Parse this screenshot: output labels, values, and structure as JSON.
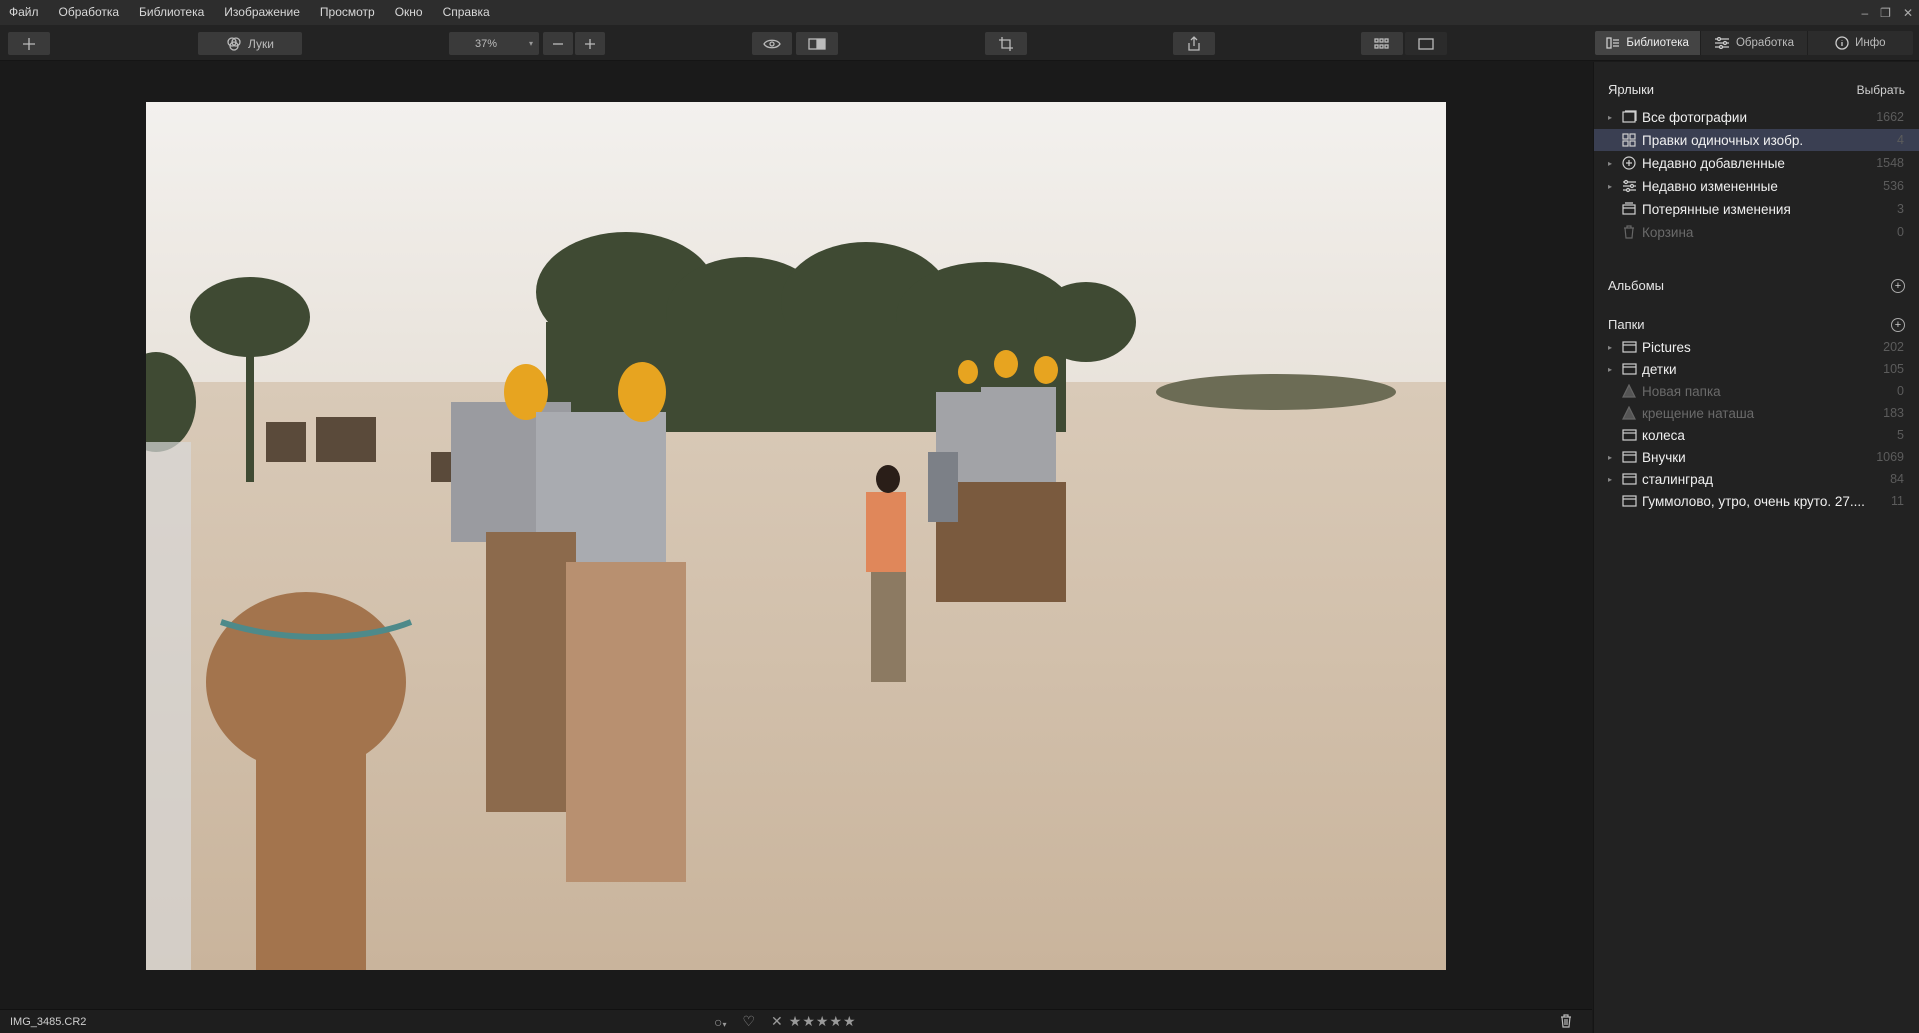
{
  "menu": [
    "Файл",
    "Обработка",
    "Библиотека",
    "Изображение",
    "Просмотр",
    "Окно",
    "Справка"
  ],
  "toolbar": {
    "luts_label": "Луки",
    "zoom_value": "37%"
  },
  "panel_tabs": [
    {
      "label": "Библиотека",
      "icon": "library-icon",
      "active": true
    },
    {
      "label": "Обработка",
      "icon": "sliders-icon",
      "active": false
    },
    {
      "label": "Инфо",
      "icon": "info-icon",
      "active": false
    }
  ],
  "shortcuts": {
    "title": "Ярлыки",
    "action": "Выбрать",
    "items": [
      {
        "label": "Все фотографии",
        "count": "1662",
        "icon": "photo-icon",
        "expand": true
      },
      {
        "label": "Правки одиночных изобр.",
        "count": "4",
        "icon": "grid-icon",
        "expand": false,
        "selected": true
      },
      {
        "label": "Недавно добавленные",
        "count": "1548",
        "icon": "plus-circle-icon",
        "expand": true
      },
      {
        "label": "Недавно измененные",
        "count": "536",
        "icon": "sliders-icon",
        "expand": true
      },
      {
        "label": "Потерянные изменения",
        "count": "3",
        "icon": "box-icon",
        "expand": false
      },
      {
        "label": "Корзина",
        "count": "0",
        "icon": "trash-icon",
        "expand": false,
        "dim": true
      }
    ]
  },
  "albums": {
    "title": "Альбомы"
  },
  "folders": {
    "title": "Папки",
    "items": [
      {
        "label": "Pictures",
        "count": "202",
        "icon": "folder-icon",
        "expand": true
      },
      {
        "label": "детки",
        "count": "105",
        "icon": "folder-icon",
        "expand": true
      },
      {
        "label": "Новая папка",
        "count": "0",
        "icon": "warning-icon",
        "expand": false,
        "dim": true
      },
      {
        "label": "крещение наташа",
        "count": "183",
        "icon": "warning-icon",
        "expand": false,
        "dim": true
      },
      {
        "label": "колеса",
        "count": "5",
        "icon": "folder-icon",
        "expand": false
      },
      {
        "label": "Внучки",
        "count": "1069",
        "icon": "folder-icon",
        "expand": true
      },
      {
        "label": "сталинград",
        "count": "84",
        "icon": "folder-icon",
        "expand": true
      },
      {
        "label": "Гуммолово, утро, очень круто. 27....",
        "count": "11",
        "icon": "folder-icon",
        "expand": false
      }
    ]
  },
  "status": {
    "filename": "IMG_3485.CR2"
  }
}
